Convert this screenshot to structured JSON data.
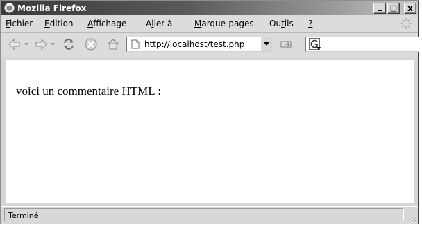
{
  "window": {
    "title": "Mozilla Firefox",
    "controls": {
      "minimize": "_",
      "maximize": "□",
      "close": "x"
    }
  },
  "menu": [
    {
      "label": "Fichier",
      "underline": "F",
      "rest": "ichier"
    },
    {
      "label": "Edition",
      "underline": "E",
      "rest": "dition"
    },
    {
      "label": "Affichage",
      "underline": "A",
      "rest": "ffichage"
    },
    {
      "label": "Aller à",
      "pre": "A",
      "underline": "l",
      "rest": "ler à"
    },
    {
      "label": "Marque-pages",
      "underline": "M",
      "rest": "arque-pages"
    },
    {
      "label": "Outils",
      "pre": "Ou",
      "underline": "t",
      "rest": "ils"
    },
    {
      "label": "?",
      "underline": "?",
      "rest": ""
    }
  ],
  "toolbar": {
    "icons": [
      "back-icon",
      "forward-icon",
      "reload-icon",
      "stop-icon",
      "home-icon",
      "go-icon"
    ],
    "url": "http://localhost/test.php",
    "search_value": ""
  },
  "page": {
    "text": "voici un commentaire HTML :"
  },
  "status": {
    "text": "Terminé"
  },
  "colors": {
    "chrome": "#dcdcdc",
    "title_gradient_start": "#3a3a3a",
    "content_bg": "#ffffff"
  }
}
